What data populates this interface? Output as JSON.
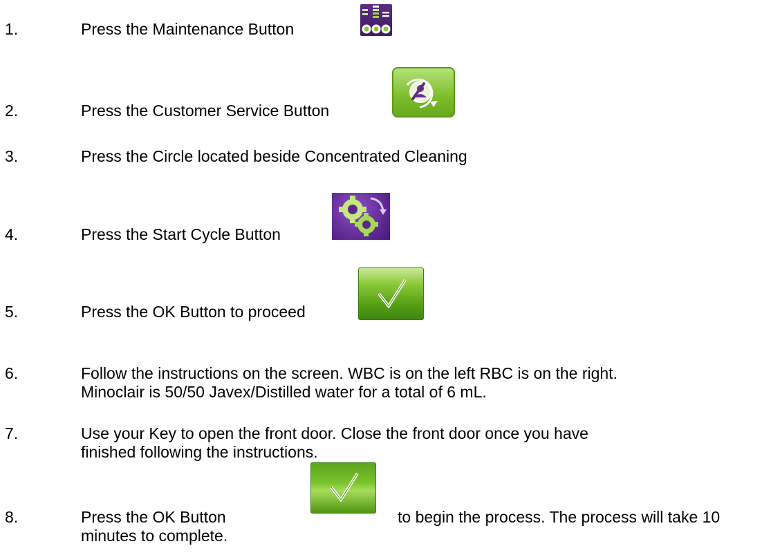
{
  "steps": [
    {
      "number": "1.",
      "text": "Press the Maintenance Button"
    },
    {
      "number": "2.",
      "text": "Press the Customer Service Button"
    },
    {
      "number": "3.",
      "text": "Press the Circle located beside Concentrated Cleaning"
    },
    {
      "number": "4.",
      "text": "Press the Start Cycle Button"
    },
    {
      "number": "5.",
      "text": "Press the OK Button to proceed"
    },
    {
      "number": "6.",
      "line1": "Follow the instructions on the screen. WBC is on the left RBC is on the right.",
      "line2": "Minoclair is 50/50 Javex/Distilled water for a total of 6 mL."
    },
    {
      "number": "7.",
      "line1": "Use your Key to open the front door. Close the front door once you have",
      "line2": "finished following the instructions."
    },
    {
      "number": "8.",
      "before": "Press the OK Button",
      "after": "to begin the process. The process will take 10",
      "line2": "minutes to complete."
    }
  ],
  "icons": {
    "maintenance": "maintenance-icon",
    "customer_service": "customer-service-icon",
    "start_cycle": "start-cycle-icon",
    "ok": "checkmark-icon"
  }
}
